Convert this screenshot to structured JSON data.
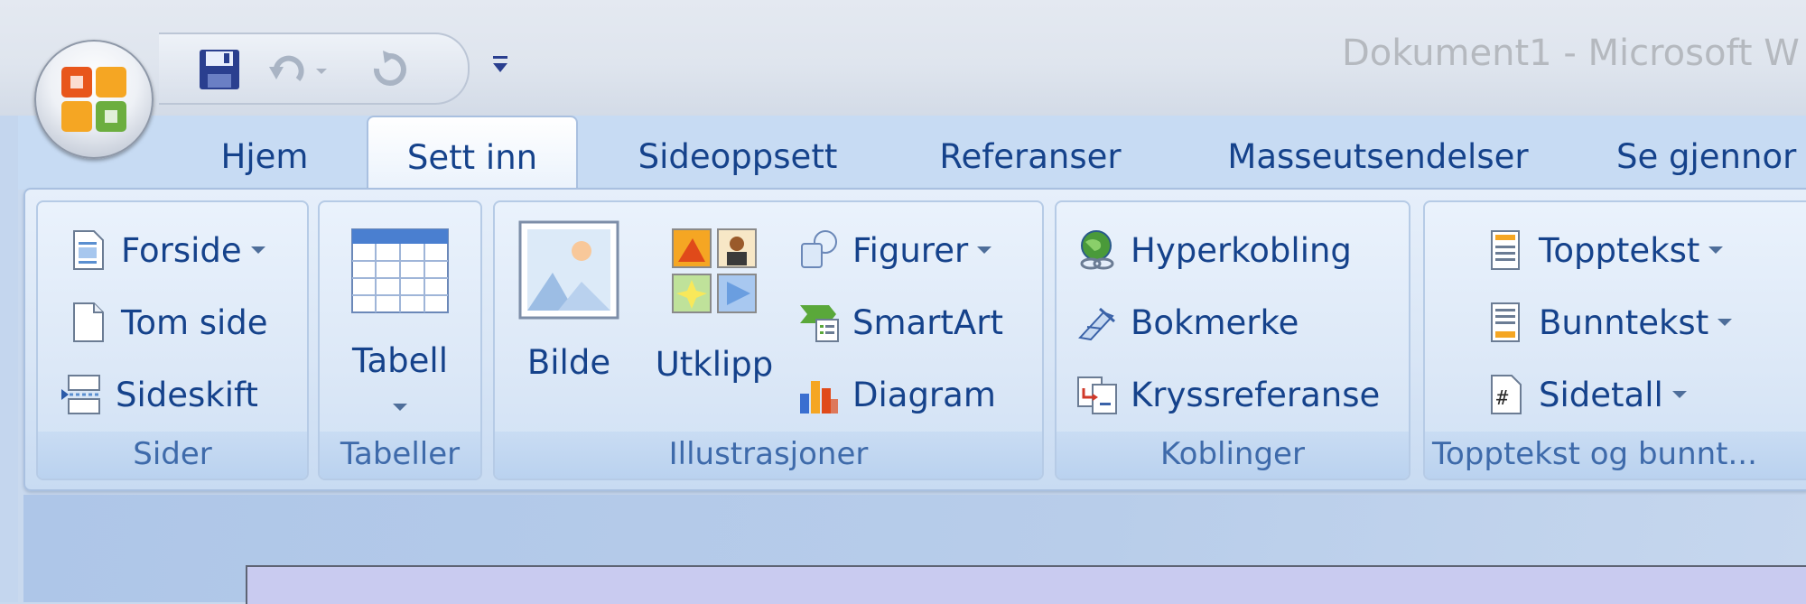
{
  "window": {
    "title": "Dokument1 - Microsoft W"
  },
  "quick_access": {
    "save_icon": "save-icon",
    "undo_icon": "undo-icon",
    "redo_icon": "redo-icon",
    "customize_icon": "customize-qat-icon"
  },
  "tabs": [
    {
      "label": "Hjem",
      "active": false
    },
    {
      "label": "Sett inn",
      "active": true
    },
    {
      "label": "Sideoppsett",
      "active": false
    },
    {
      "label": "Referanser",
      "active": false
    },
    {
      "label": "Masseutsendelser",
      "active": false
    },
    {
      "label": "Se gjennor",
      "active": false
    }
  ],
  "groups": {
    "sider": {
      "label": "Sider",
      "items": [
        {
          "label": "Forside",
          "icon": "cover-page-icon",
          "dropdown": true
        },
        {
          "label": "Tom side",
          "icon": "blank-page-icon",
          "dropdown": false
        },
        {
          "label": "Sideskift",
          "icon": "page-break-icon",
          "dropdown": false
        }
      ]
    },
    "tabeller": {
      "label": "Tabeller",
      "items": [
        {
          "label": "Tabell",
          "icon": "table-icon",
          "dropdown": true
        }
      ]
    },
    "illustrasjoner": {
      "label": "Illustrasjoner",
      "big": [
        {
          "label": "Bilde",
          "icon": "picture-icon"
        },
        {
          "label": "Utklipp",
          "icon": "clipart-icon"
        }
      ],
      "small": [
        {
          "label": "Figurer",
          "icon": "shapes-icon",
          "dropdown": true
        },
        {
          "label": "SmartArt",
          "icon": "smartart-icon",
          "dropdown": false
        },
        {
          "label": "Diagram",
          "icon": "chart-icon",
          "dropdown": false
        }
      ]
    },
    "koblinger": {
      "label": "Koblinger",
      "items": [
        {
          "label": "Hyperkobling",
          "icon": "hyperlink-icon"
        },
        {
          "label": "Bokmerke",
          "icon": "bookmark-icon"
        },
        {
          "label": "Kryssreferanse",
          "icon": "cross-reference-icon"
        }
      ]
    },
    "topptekst": {
      "label": "Topptekst og bunnt...",
      "items": [
        {
          "label": "Topptekst",
          "icon": "header-icon",
          "dropdown": true
        },
        {
          "label": "Bunntekst",
          "icon": "footer-icon",
          "dropdown": true
        },
        {
          "label": "Sidetall",
          "icon": "page-number-icon",
          "dropdown": true
        }
      ]
    }
  },
  "colors": {
    "accent_text": "#15428b",
    "group_label": "#3e6aaa",
    "ribbon_bg": "#dce8f7"
  }
}
